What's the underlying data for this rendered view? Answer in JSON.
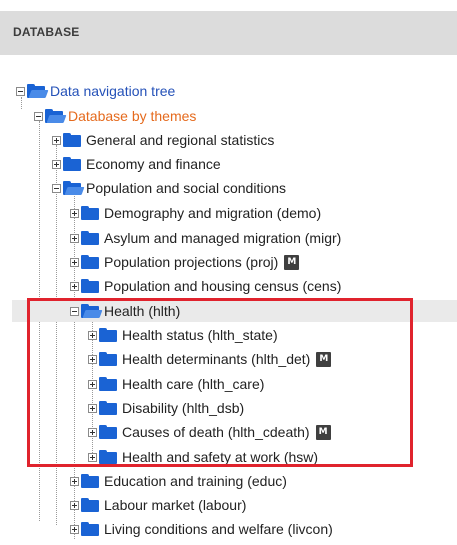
{
  "header": {
    "title": "DATABASE"
  },
  "tree": [
    {
      "label": "Data navigation tree",
      "state": "open",
      "style": "link"
    },
    {
      "label": "Database by themes",
      "state": "open",
      "style": "orange"
    },
    {
      "label": "General and regional statistics",
      "state": "closed"
    },
    {
      "label": "Economy and finance",
      "state": "closed"
    },
    {
      "label": "Population and social conditions",
      "state": "open"
    },
    {
      "label": "Demography and migration (demo)",
      "state": "closed"
    },
    {
      "label": "Asylum and managed migration (migr)",
      "state": "closed"
    },
    {
      "label": "Population projections (proj)",
      "state": "closed",
      "badge": "M"
    },
    {
      "label": "Population and housing census (cens)",
      "state": "closed"
    },
    {
      "label": "Health (hlth)",
      "state": "open",
      "selected": true
    },
    {
      "label": "Health status (hlth_state)",
      "state": "closed"
    },
    {
      "label": "Health determinants (hlth_det)",
      "state": "closed",
      "badge": "M"
    },
    {
      "label": "Health care (hlth_care)",
      "state": "closed"
    },
    {
      "label": "Disability (hlth_dsb)",
      "state": "closed"
    },
    {
      "label": "Causes of death (hlth_cdeath)",
      "state": "closed",
      "badge": "M"
    },
    {
      "label": "Health and safety at work (hsw)",
      "state": "closed"
    },
    {
      "label": "Education and training (educ)",
      "state": "closed"
    },
    {
      "label": "Labour market (labour)",
      "state": "closed"
    },
    {
      "label": "Living conditions and welfare (livcon)",
      "state": "closed"
    }
  ],
  "colors": {
    "folder": "#1a63d4",
    "link": "#2451b8",
    "active_theme": "#e56a1d",
    "highlight": "#e0232d",
    "header_bg": "#dcdcdc"
  }
}
